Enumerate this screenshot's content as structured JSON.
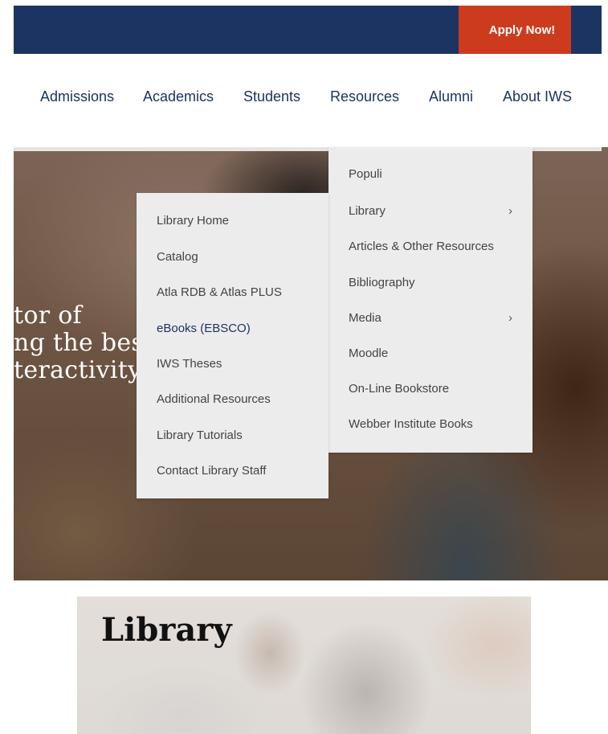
{
  "header": {
    "apply_label": "Apply Now!"
  },
  "nav": {
    "items": [
      {
        "label": "Admissions"
      },
      {
        "label": "Academics"
      },
      {
        "label": "Students"
      },
      {
        "label": "Resources"
      },
      {
        "label": "Alumni"
      },
      {
        "label": "About IWS"
      }
    ]
  },
  "hero": {
    "lines": [
      "tor of",
      "ng the best",
      "teractivity."
    ]
  },
  "resources_menu": {
    "items": [
      {
        "label": "Populi"
      },
      {
        "label": "Library",
        "submenu": true
      },
      {
        "label": "Articles & Other Resources"
      },
      {
        "label": "Bibliography"
      },
      {
        "label": "Media",
        "submenu": true
      },
      {
        "label": "Moodle"
      },
      {
        "label": "On-Line Bookstore"
      },
      {
        "label": "Webber Institute Books"
      }
    ],
    "chevron": "›"
  },
  "library_menu": {
    "items": [
      {
        "label": "Library Home"
      },
      {
        "label": "Catalog"
      },
      {
        "label": "Atla RDB & Atlas PLUS"
      },
      {
        "label": "eBooks (EBSCO)",
        "active": true
      },
      {
        "label": "IWS Theses"
      },
      {
        "label": "Additional Resources"
      },
      {
        "label": "Library Tutorials"
      },
      {
        "label": "Contact Library Staff"
      }
    ]
  },
  "page": {
    "title": "Library"
  },
  "colors": {
    "navy": "#1c3461",
    "apply_red": "#cd3b1f",
    "menu_bg": "#ececec"
  }
}
